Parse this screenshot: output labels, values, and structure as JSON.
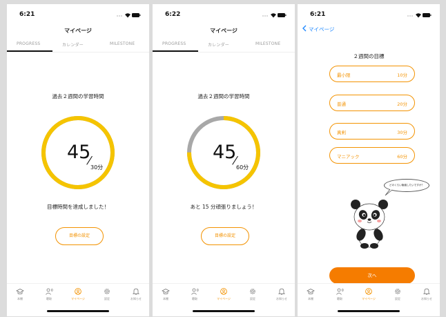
{
  "colors": {
    "accent": "#f39200",
    "ring": "#f5c400",
    "ring_rest": "#a8a8a8",
    "link": "#1e88ff"
  },
  "tabs": [
    "PROGRESS",
    "カレンダー",
    "MILESTONE"
  ],
  "tabbar": [
    {
      "label": "本棚",
      "icon": "graduation-cap-icon"
    },
    {
      "label": "聴取",
      "icon": "listener-icon"
    },
    {
      "label": "マイページ",
      "icon": "profile-icon"
    },
    {
      "label": "設定",
      "icon": "gear-icon"
    },
    {
      "label": "お知らせ",
      "icon": "bell-icon"
    }
  ],
  "screen1": {
    "time": "6:21",
    "title": "マイページ",
    "subtitle": "過去２週間の学習時間",
    "value": "45",
    "target": "30分",
    "progress": 1.0,
    "message": "目標時間を達成しました！",
    "button": "目標の設定"
  },
  "screen2": {
    "time": "6:22",
    "title": "マイページ",
    "subtitle": "過去２週間の学習時間",
    "value": "45",
    "target": "60分",
    "progress": 0.75,
    "message": "あと 15 分頑張りましょう！",
    "button": "目標の設定"
  },
  "screen3": {
    "time": "6:21",
    "back": "マイページ",
    "heading": "２週間の目標",
    "options": [
      {
        "label": "最小限",
        "value": "10分"
      },
      {
        "label": "普通",
        "value": "20分"
      },
      {
        "label": "真剣",
        "value": "30分"
      },
      {
        "label": "マニアック",
        "value": "60分"
      }
    ],
    "bubble": "どのくらい勉強したいですか？",
    "next": "次へ"
  }
}
